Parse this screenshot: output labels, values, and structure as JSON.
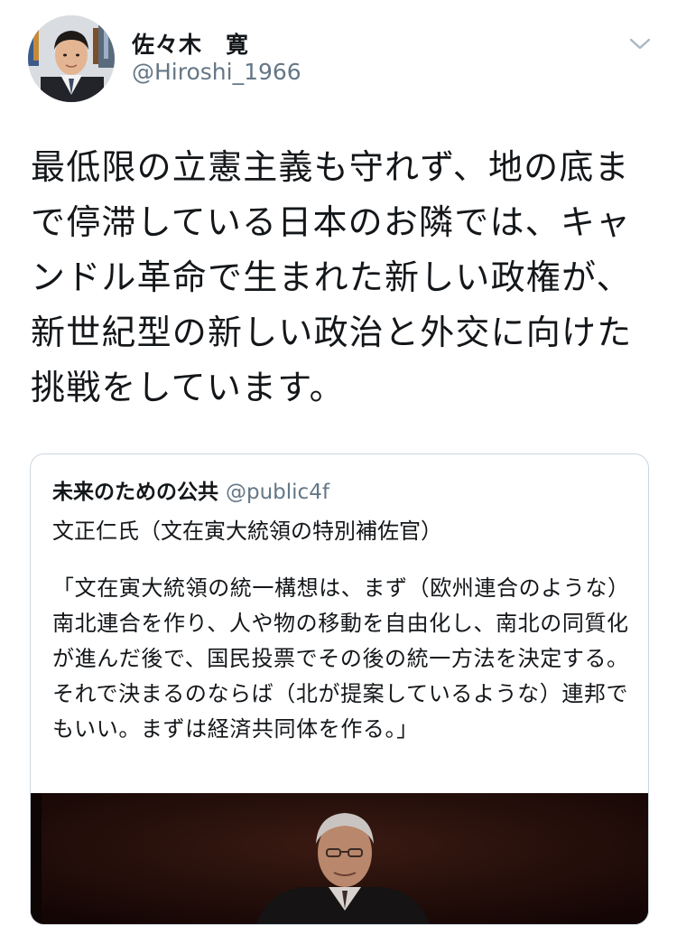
{
  "author": {
    "display_name": "佐々木　寛",
    "handle": "@Hiroshi_1966"
  },
  "tweet": {
    "text": "最低限の立憲主義も守れず、地の底まで停滞している日本のお隣では、キャンドル革命で生まれた新しい政権が、新世紀型の新しい政治と外交に向けた挑戦をしています。"
  },
  "quoted_tweet": {
    "display_name": "未来のための公共",
    "handle": "@public4f",
    "line1": "文正仁氏（文在寅大統領の特別補佐官）",
    "body": "「文在寅大統領の統一構想は、まず（欧州連合のような）南北連合を作り、人や物の移動を自由化し、南北の同質化が進んだ後で、国民投票でその後の統一方法を決定する。それで決まるのならば（北が提案しているような）連邦でもいい。まずは経済共同体を作る。」"
  },
  "icons": {
    "menu": "chevron-down-icon"
  },
  "colors": {
    "text": "#14171a",
    "secondary": "#657786",
    "border": "#ccd6dd",
    "media_background": "#1c0a06"
  }
}
